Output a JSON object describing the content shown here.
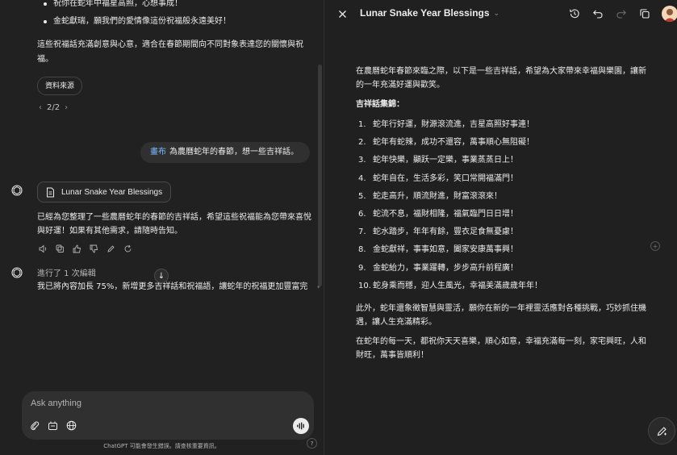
{
  "chat": {
    "top_bullets": [
      "祝你在蛇年中福星高照，心想事成！",
      "金蛇獻瑞，願我們的愛情像這份祝福般永遠美好！"
    ],
    "summary": "這些祝福話充滿創意與心意，適合在春節期間向不同對象表達您的關懷與祝福。",
    "source_button": "資料來源",
    "pager": "2/2",
    "user_message": {
      "mention": "畫布",
      "text": "為農曆蛇年的春節，想一些吉祥話。"
    },
    "canvas_chip_label": "Lunar Snake Year Blessings",
    "reply_1": "已經為您整理了一些農曆蛇年的春節的吉祥話，希望這些祝福能為您帶來喜悅與好運！如果有其他需求，請隨時告知。",
    "edit_note": "進行了 1 次編輯",
    "reply_2": "我已將內容加長 75%，新增更多吉祥話和祝福語，讓蛇年的祝福更加豐富完",
    "composer_placeholder": "Ask anything",
    "disclaimer": "ChatGPT 可能會發生錯誤。請查核重要資訊。",
    "help_label": "?"
  },
  "canvas": {
    "title": "Lunar Snake Year Blessings",
    "intro": "在農曆蛇年春節來臨之際，以下是一些吉祥話，希望為大家帶來幸福與樂園，讓新的一年充滿好運與歡笑。",
    "section_title": "吉祥話集錦：",
    "items": [
      {
        "num": "1.",
        "text": "蛇年行好運，財源滾流進，吉星高照好事連！"
      },
      {
        "num": "2.",
        "text": "蛇年有蛇辣，成功不還容，萬事順心無阻礙！"
      },
      {
        "num": "3.",
        "text": "蛇年快樂，顯跃一定樂，事業蒸蒸日上！"
      },
      {
        "num": "4.",
        "text": "蛇年自在，生活多彩，笑口常開福滿門！"
      },
      {
        "num": "5.",
        "text": "蛇走高升，順流財進，財富滾滾來！"
      },
      {
        "num": "6.",
        "text": "蛇流不息，福財相隆，福氣臨門日日增！"
      },
      {
        "num": "7.",
        "text": "蛇水踏步，年年有餘，豐衣足食無憂慮！"
      },
      {
        "num": "8.",
        "text": "金蛇獻祥，事事如意，闔家安康萬事興！"
      },
      {
        "num": "9.",
        "text": "金蛇紿力，事業躍轉，步步高升前程廣！"
      },
      {
        "num": "10.",
        "text": "蛇身乘而穩，迎人生風光，幸福美滿歲歲年年！"
      }
    ],
    "para_2": "此外，蛇年還象徵智慧與靈活，願你在新的一年裡靈活應對各種挑戰，巧妙抓住機遇，讓人生充滿精彩。",
    "para_3": "在蛇年的每一天，都祝你天天喜樂，順心如意，幸福充滿每一刻，家宅興旺，人和財旺，萬事皆順利！"
  },
  "colors": {
    "background": "#212121",
    "canvas_background": "#202020",
    "bubble": "#303030",
    "mention": "#7ab7ff"
  }
}
